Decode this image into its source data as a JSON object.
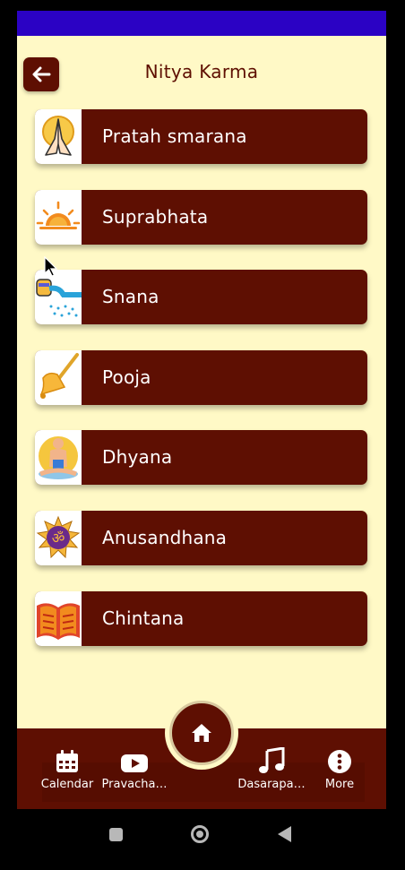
{
  "header": {
    "title": "Nitya Karma",
    "back_icon": "arrow-left-icon"
  },
  "items": [
    {
      "label": "Pratah smarana",
      "icon": "praying-hands-icon"
    },
    {
      "label": "Suprabhata",
      "icon": "sunrise-icon"
    },
    {
      "label": "Snana",
      "icon": "water-pot-icon"
    },
    {
      "label": "Pooja",
      "icon": "bell-icon"
    },
    {
      "label": "Dhyana",
      "icon": "meditation-icon"
    },
    {
      "label": "Anusandhana",
      "icon": "om-icon"
    },
    {
      "label": "Chintana",
      "icon": "book-icon"
    }
  ],
  "nav": {
    "home_icon": "home-icon",
    "items": [
      {
        "label": "Calendar",
        "icon": "calendar-icon"
      },
      {
        "label": "Pravacha…",
        "icon": "youtube-icon"
      },
      {
        "label": "Dasarapa…",
        "icon": "music-note-icon"
      },
      {
        "label": "More",
        "icon": "more-icon"
      }
    ]
  },
  "colors": {
    "primary": "#5e0f02",
    "background": "#fff9c6",
    "status_bar": "#2b02c4"
  }
}
